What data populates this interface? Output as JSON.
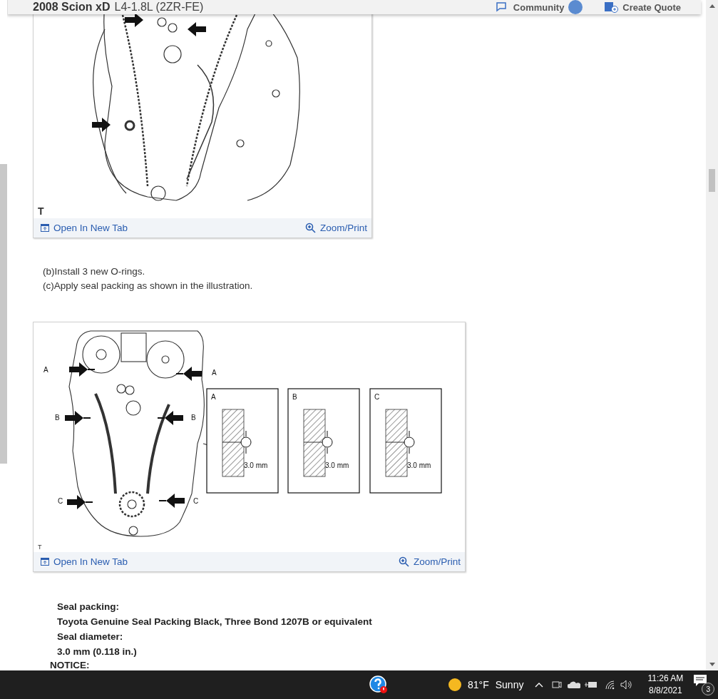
{
  "header": {
    "title": "2008 Scion xD",
    "subtitle": "L4-1.8L (2ZR-FE)",
    "community": "Community",
    "create_quote": "Create Quote"
  },
  "figures": [
    {
      "kind": "orings",
      "corner_mark": "T",
      "open_link": "Open In New Tab",
      "zoom_link": "Zoom/Print"
    },
    {
      "kind": "seal",
      "corner_mark": "T",
      "open_link": "Open In New Tab",
      "zoom_link": "Zoom/Print",
      "callouts": [
        "A",
        "A",
        "B",
        "B",
        "C",
        "C"
      ],
      "details": [
        {
          "label": "A",
          "dimension": "3.0 mm"
        },
        {
          "label": "B",
          "dimension": "3.0 mm"
        },
        {
          "label": "C",
          "dimension": "3.0 mm"
        }
      ]
    }
  ],
  "steps": [
    "(b)Install 3 new O-rings.",
    "(c)Apply seal packing as shown in the illustration."
  ],
  "specs": [
    "Seal packing:",
    "Toyota Genuine Seal Packing Black, Three Bond 1207B or equivalent",
    "Seal diameter:",
    "3.0 mm (0.118 in.)"
  ],
  "notice": "NOTICE:",
  "taskbar": {
    "temperature": "81°F",
    "weather": "Sunny",
    "time": "11:26 AM",
    "date": "8/8/2021",
    "notification_count": "3"
  }
}
